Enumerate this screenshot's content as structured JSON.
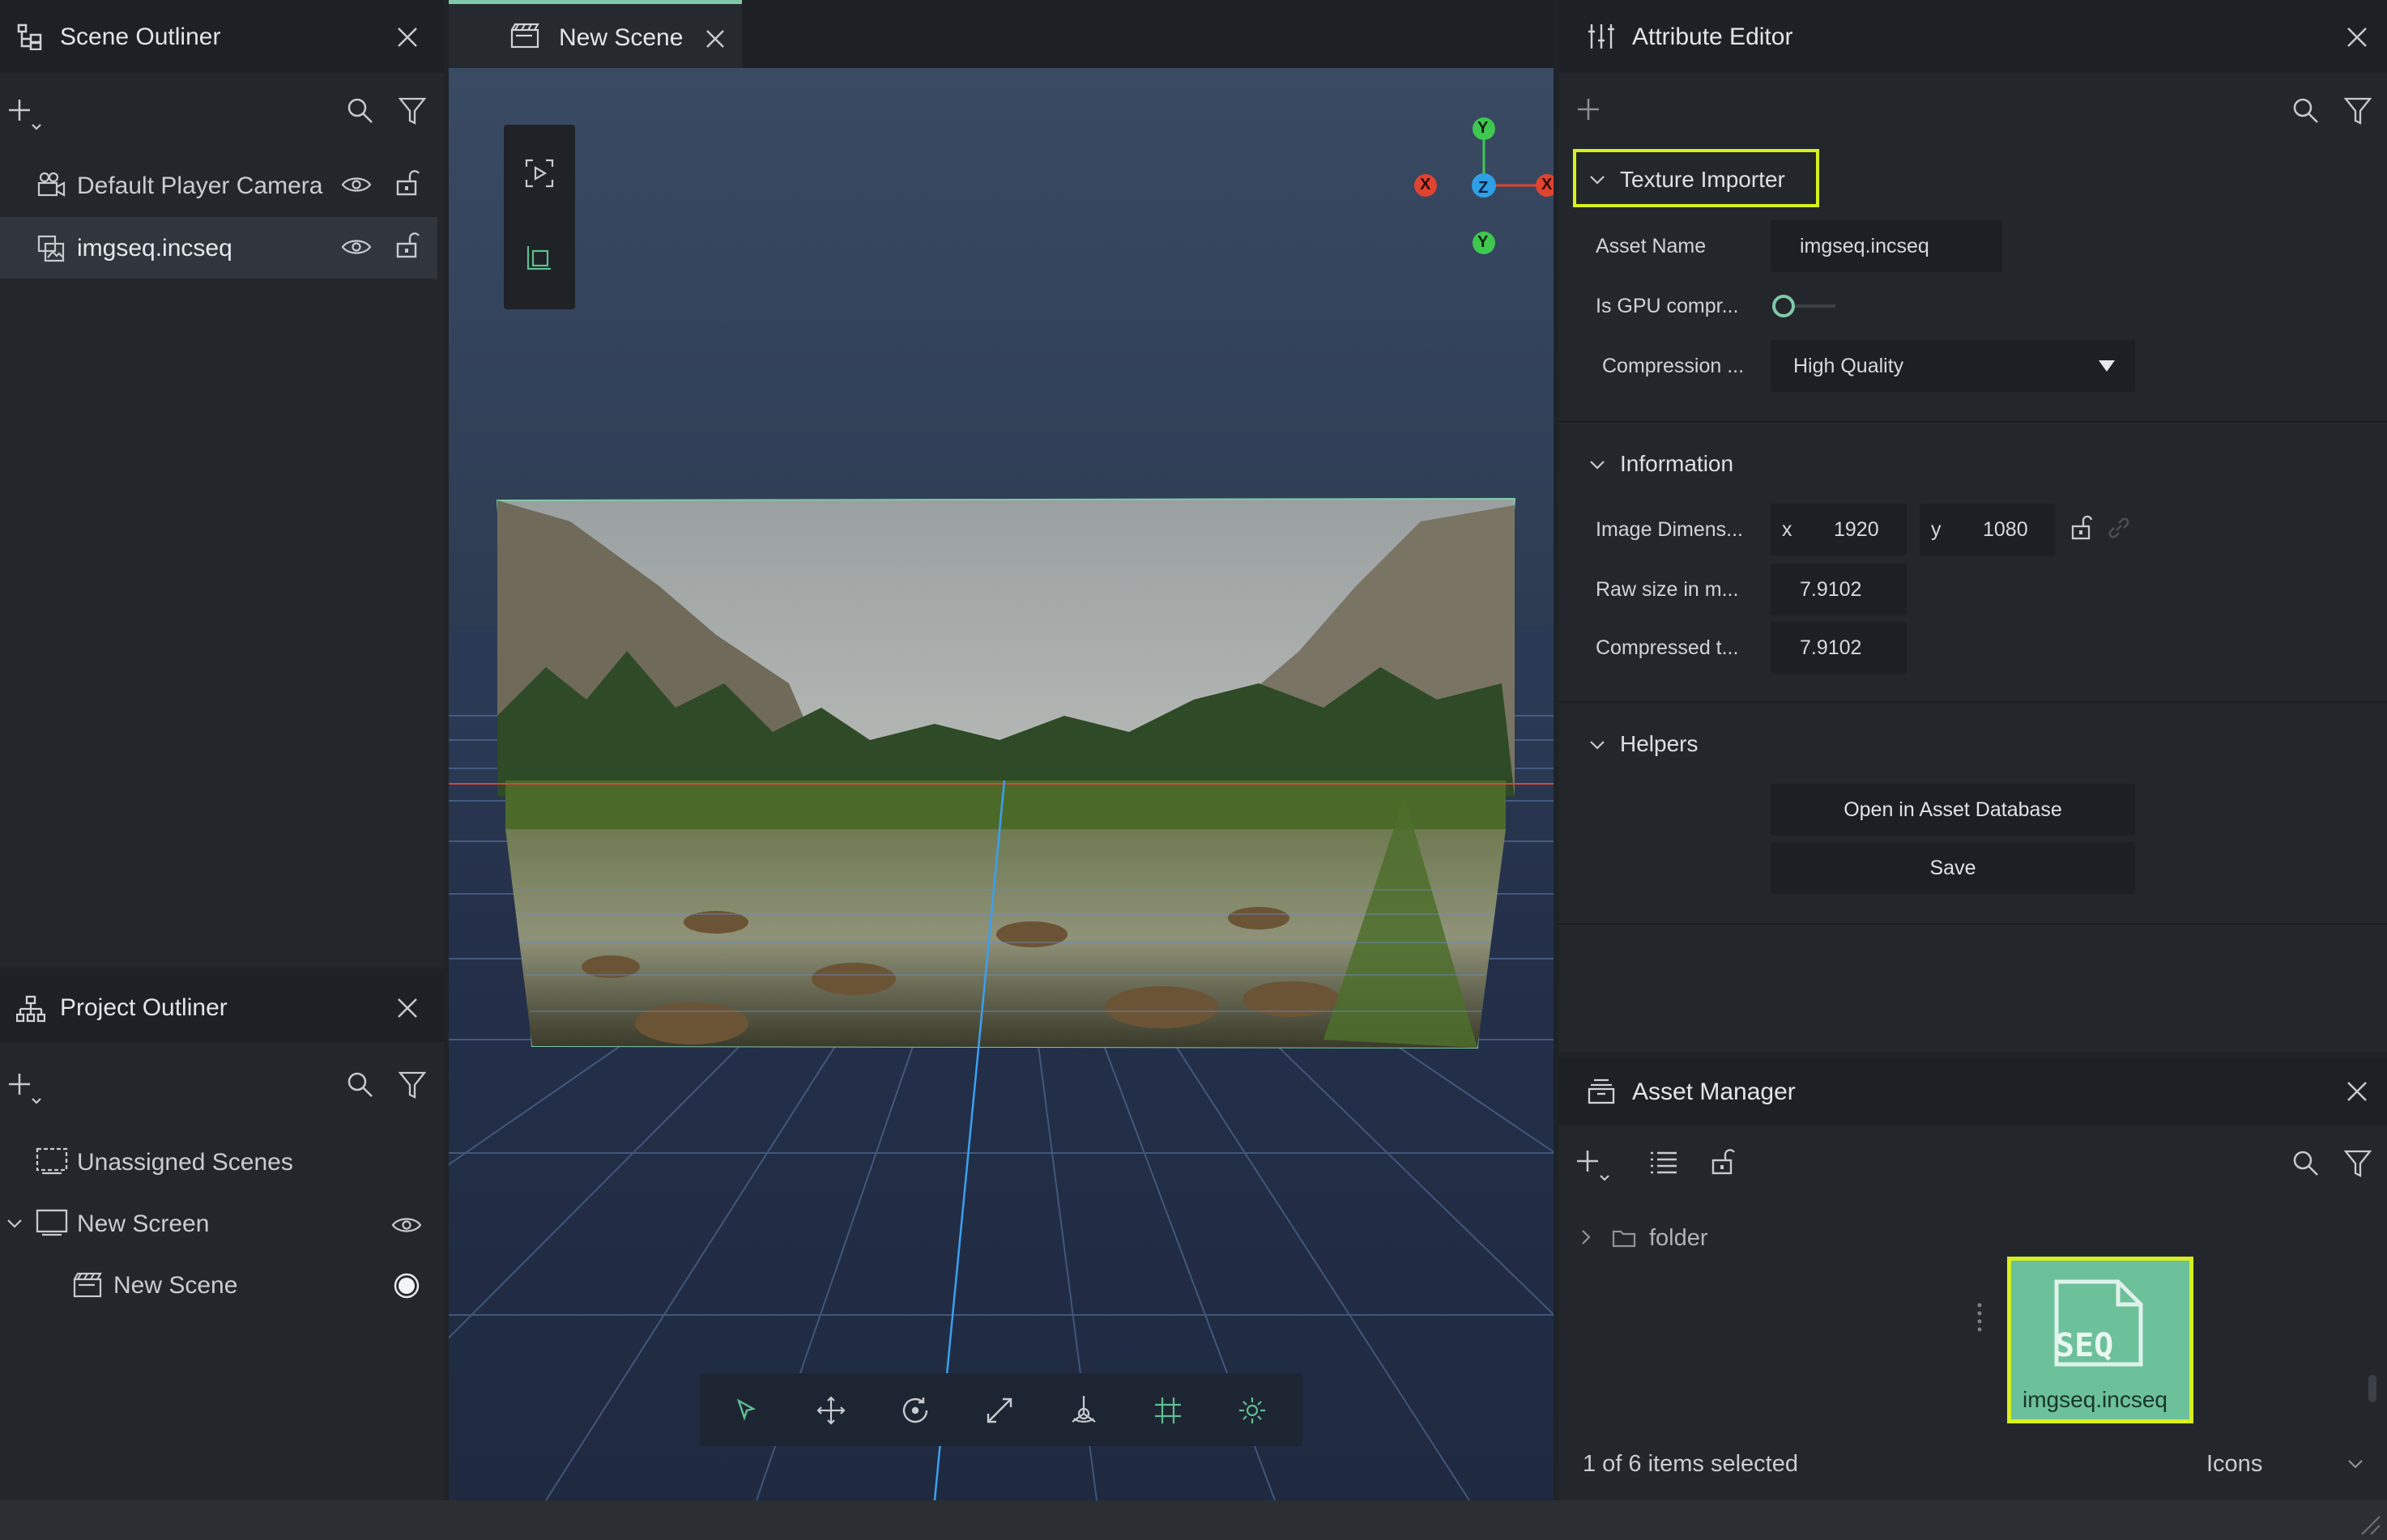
{
  "scene_outliner": {
    "title": "Scene Outliner",
    "items": [
      {
        "label": "Default Player Camera"
      },
      {
        "label": "imgseq.incseq"
      }
    ]
  },
  "project_outliner": {
    "title": "Project Outliner",
    "items": [
      {
        "label": "Unassigned Scenes"
      },
      {
        "label": "New Screen"
      },
      {
        "label": "New Scene"
      }
    ]
  },
  "viewport": {
    "tab_label": "New Scene",
    "gizmo": {
      "y_top": "Y",
      "x_left": "X",
      "z": "Z",
      "x_right": "X",
      "y_bottom": "Y"
    }
  },
  "attribute_editor": {
    "title": "Attribute Editor",
    "texture_importer": {
      "title": "Texture Importer",
      "asset_name_label": "Asset Name",
      "asset_name_value": "imgseq.incseq",
      "gpu_label": "Is GPU compr...",
      "compression_label": "Compression ...",
      "compression_value": "High Quality"
    },
    "information": {
      "title": "Information",
      "dim_label": "Image Dimens...",
      "x_label": "x",
      "x_value": "1920",
      "y_label": "y",
      "y_value": "1080",
      "raw_label": "Raw size in m...",
      "raw_value": "7.9102",
      "comp_label": "Compressed t...",
      "comp_value": "7.9102"
    },
    "helpers": {
      "title": "Helpers",
      "open_button": "Open in Asset Database",
      "save_button": "Save"
    }
  },
  "asset_manager": {
    "title": "Asset Manager",
    "folder_label": "folder",
    "asset_tile_badge": "SEQ",
    "asset_tile_label": "imgseq.incseq",
    "status": "1 of 6 items selected",
    "view_mode": "Icons"
  },
  "colors": {
    "accent_green": "#7fc9a8",
    "highlight_yellow": "#d7f020",
    "axis_x": "#e0432f",
    "axis_y": "#3ec84f",
    "axis_z": "#2f9fe6"
  }
}
